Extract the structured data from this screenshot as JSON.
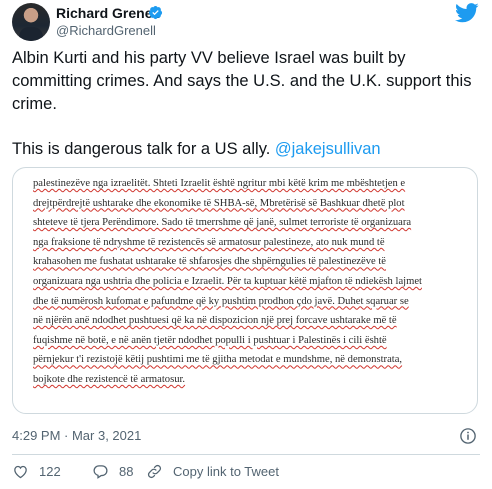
{
  "author": {
    "name": "Richard Grenell",
    "handle": "@RichardGrenell",
    "verified_icon": "verified-badge-icon",
    "avatar_icon": "avatar"
  },
  "brand": {
    "logo": "twitter-bird-icon",
    "accent": "#1d9bf0"
  },
  "tweet": {
    "paragraph1": "Albin Kurti and his party VV believe Israel was built by committing crimes. And says the U.S. and the U.K. support this crime.",
    "paragraph2_prefix": "This is dangerous talk for a US ally. ",
    "mention": "@jakejsullivan"
  },
  "attached_document": {
    "lines": [
      "palestinezëve nga izraelitët. Shteti Izraelit është ngritur mbi këtë krim me mbështetjen e",
      "drejtpërdrejtë ushtarake dhe ekonomike të SHBA-së, Mbretërisë së Bashkuar dhetë plot",
      "shteteve të tjera Perëndimore. Sado të tmerrshme që janë, sulmet terroriste të organizuara",
      "nga fraksione të ndryshme të rezistencës së armatosur palestineze, ato nuk mund të",
      "krahasohen me fushatat ushtarake të shfarosjes dhe shpërngulies të palestinezëve të",
      "organizuara nga ushtria dhe policia e Izraelit. Për ta kuptuar këtë mjafton të ndiekësh lajmet",
      "dhe të numërosh kufomat e pafundme që ky pushtim prodhon çdo javë. Duhet sqaruar se",
      "në njërën anë ndodhet pushtuesi që ka në dispozicion një prej forcave ushtarake më të",
      "fuqishme në botë, e në anën tjetër ndodhet populli i pushtuar i Palestinës i cili është",
      "përnjekur t'i rezistojë këtij pushtimi me të gjitha metodat e mundshme, në demonstrata,",
      "bojkote dhe rezistencë të armatosur."
    ],
    "underline_color": "#d0342c"
  },
  "meta": {
    "timestamp": "4:29 PM · Mar 3, 2021",
    "info_icon": "info-icon"
  },
  "actions": {
    "like_count": "122",
    "like_icon": "heart-icon",
    "reply_count": "88",
    "reply_icon": "reply-bubble-icon",
    "copy_label": "Copy link to Tweet",
    "copy_icon": "link-icon"
  }
}
